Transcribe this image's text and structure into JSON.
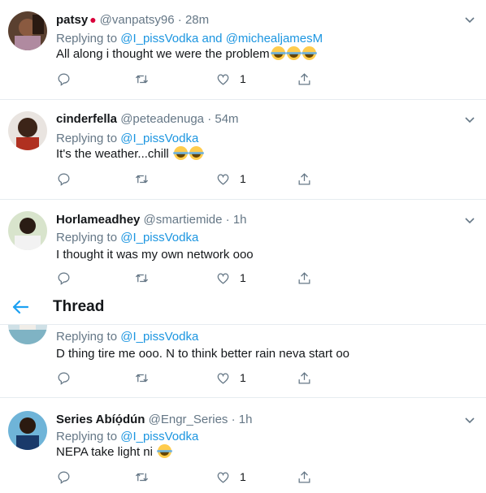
{
  "header": {
    "title": "Thread",
    "back_icon": "arrow-left-icon"
  },
  "tweets": [
    {
      "name": "patsy",
      "name_icon": "rose-icon",
      "handle": "@vanpatsy96",
      "dot": "·",
      "time": "28m",
      "replying_prefix": "Replying to",
      "replying_to": "@I_pissVodka and @michealjamesM",
      "text": "All along i thought we were the problem",
      "emojis": 3,
      "likes": "1"
    },
    {
      "name": "cinderfella",
      "handle": "@peteadenuga",
      "dot": "·",
      "time": "54m",
      "replying_prefix": "Replying to",
      "replying_to": "@I_pissVodka",
      "text": "It's the weather...chill",
      "emojis": 2,
      "likes": "1"
    },
    {
      "name": "Horlameadhey",
      "handle": "@smartiemide",
      "dot": "·",
      "time": "1h",
      "replying_prefix": "Replying to",
      "replying_to": "@I_pissVodka",
      "text": "I thought it was my own network ooo",
      "emojis": 0,
      "likes": "1"
    },
    {
      "replying_prefix": "Replying to",
      "replying_to": "@I_pissVodka",
      "text": "D thing tire me ooo. N to think better rain neva start oo",
      "emojis": 0,
      "likes": "1"
    },
    {
      "name": "Series Abíọ́dún",
      "handle": "@Engr_Series",
      "dot": "·",
      "time": "1h",
      "replying_prefix": "Replying to",
      "replying_to": "@I_pissVodka",
      "text": "NEPA take light ni",
      "emojis": 1,
      "likes": "1"
    }
  ],
  "colors": {
    "link": "#1b95e0",
    "muted": "#657786",
    "divider": "#e6ecf0",
    "text": "#14171a"
  }
}
